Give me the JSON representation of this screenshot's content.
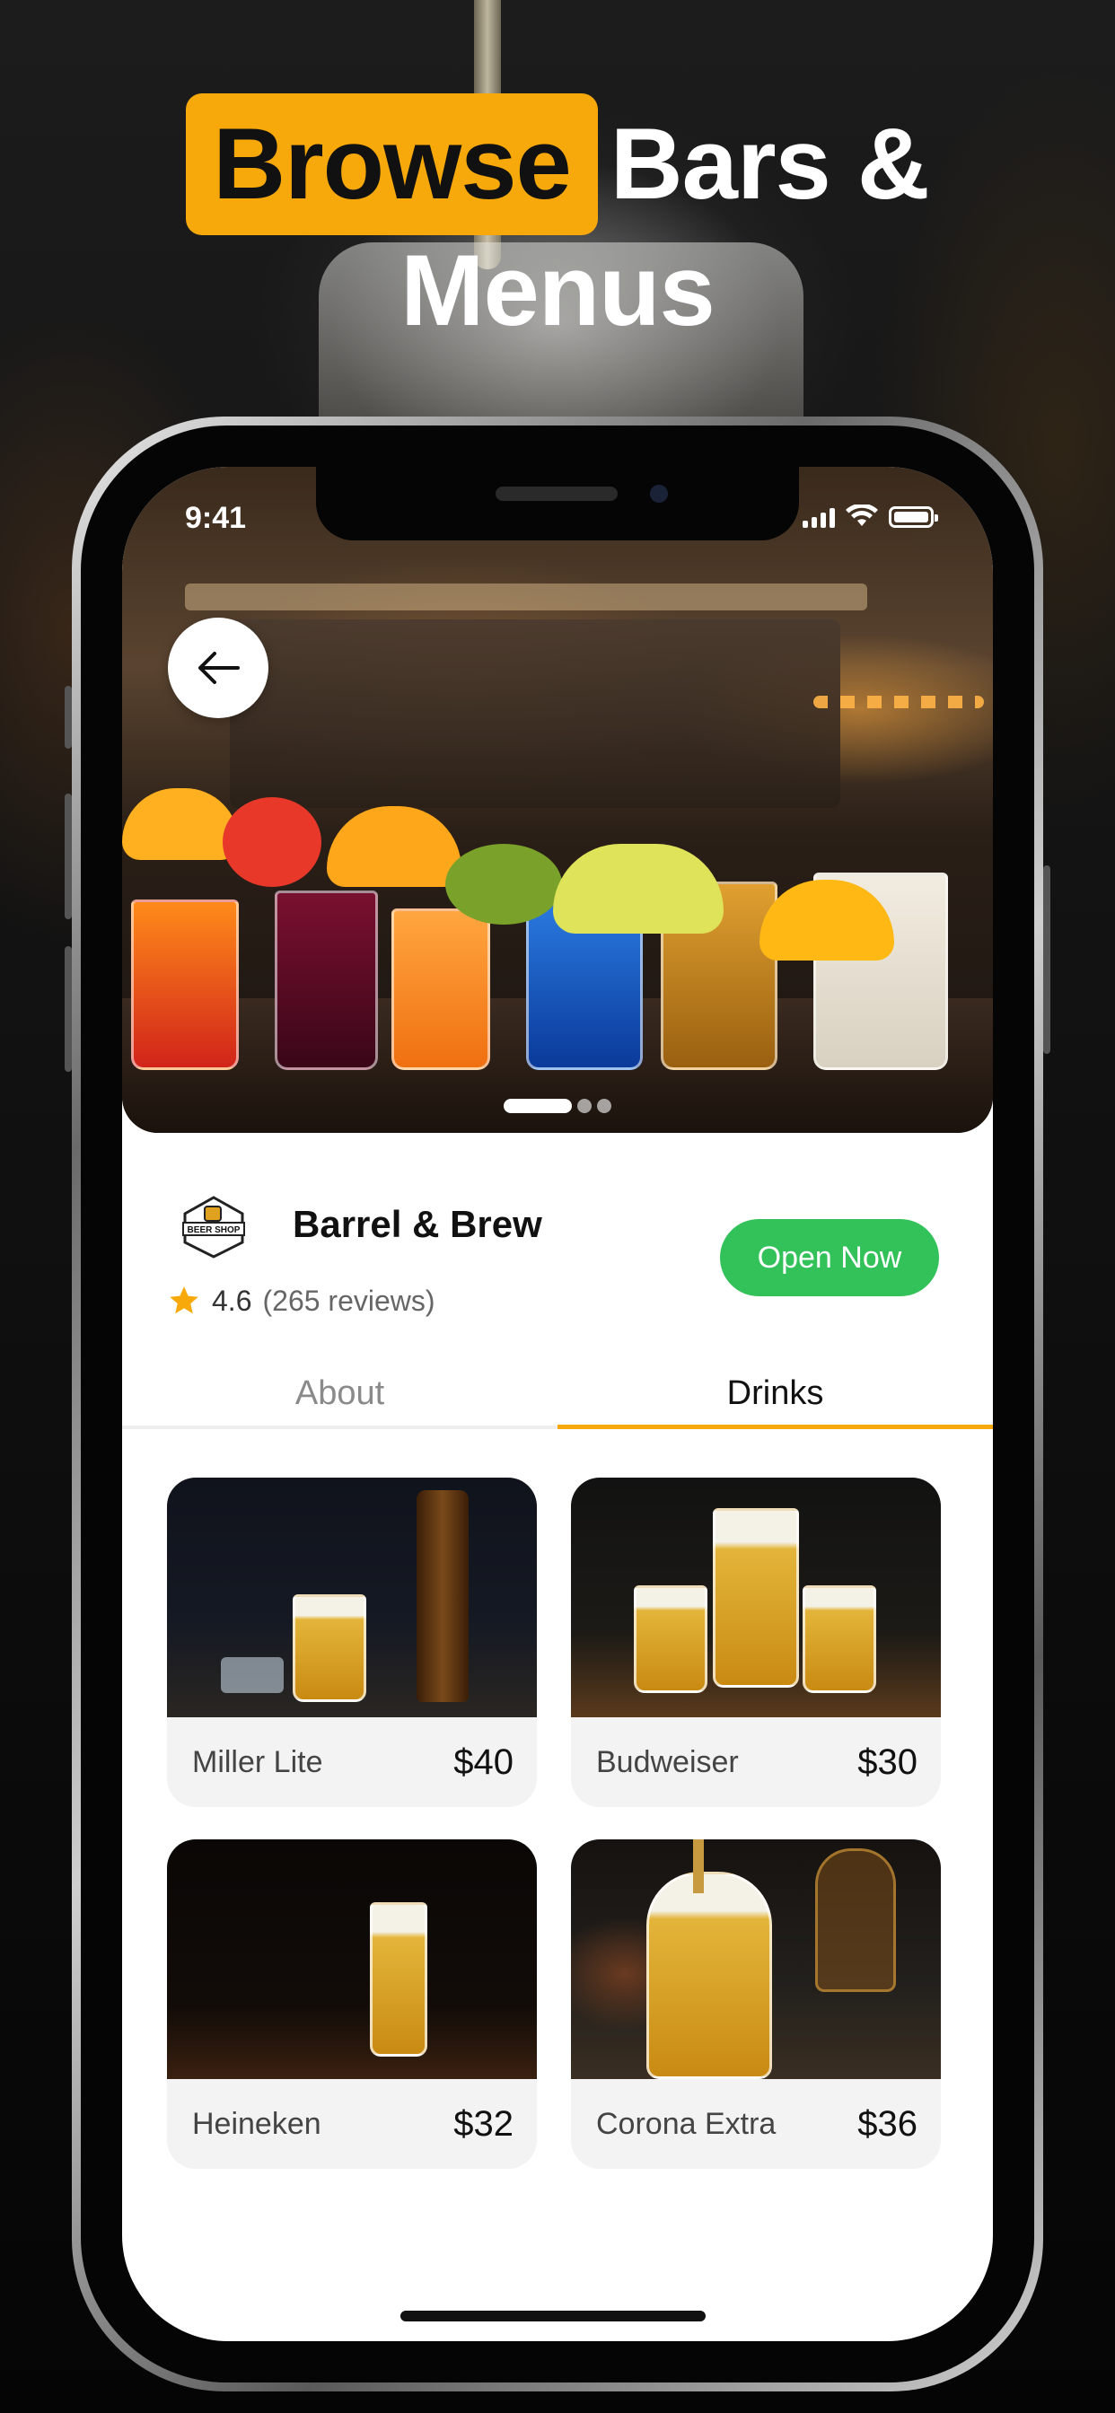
{
  "headline": {
    "highlight": "Browse",
    "rest": "Bars &",
    "line2": "Menus"
  },
  "status_bar": {
    "time": "9:41"
  },
  "venue": {
    "logo_text": "BEER SHOP",
    "name": "Barrel & Brew",
    "status_button": "Open Now",
    "rating": "4.6",
    "reviews": "(265 reviews)"
  },
  "tabs": [
    {
      "label": "About",
      "active": false
    },
    {
      "label": "Drinks",
      "active": true
    }
  ],
  "carousel": {
    "slides": 3,
    "active_index": 0
  },
  "drinks": [
    {
      "name": "Miller Lite",
      "price": "$40"
    },
    {
      "name": "Budweiser",
      "price": "$30"
    },
    {
      "name": "Heineken",
      "price": "$32"
    },
    {
      "name": "Corona Extra",
      "price": "$36"
    }
  ],
  "colors": {
    "accent": "#f7a90c",
    "open_green": "#33c15a",
    "star": "#f7a90c"
  },
  "icons": {
    "back": "arrow-left-icon",
    "star": "star-icon",
    "signal": "cellular-signal-icon",
    "wifi": "wifi-icon",
    "battery": "battery-icon"
  }
}
